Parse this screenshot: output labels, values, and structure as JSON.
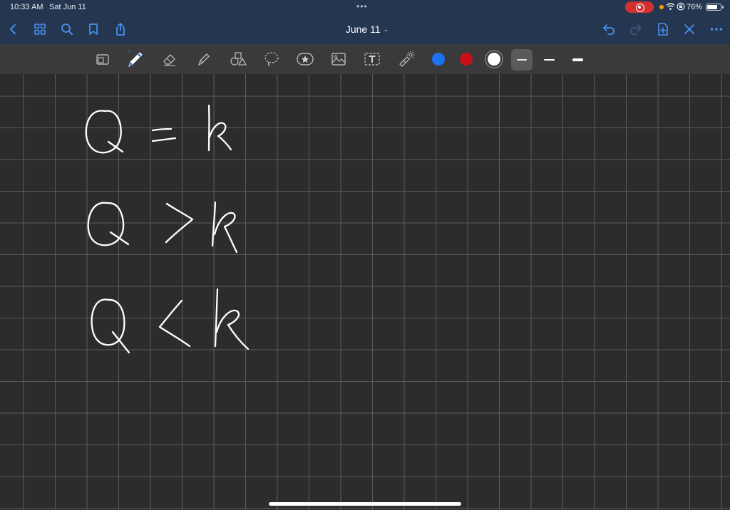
{
  "status_bar": {
    "time": "10:33 AM",
    "date": "Sat Jun 11",
    "battery_percent": "76%",
    "battery_level": 0.76,
    "icons": [
      "screen-record-icon",
      "wifi-icon",
      "rotation-lock-icon",
      "battery-icon"
    ]
  },
  "nav_bar": {
    "title": "June 11",
    "left_buttons": [
      "back-icon",
      "grid-icon",
      "search-icon",
      "bookmark-icon",
      "share-icon"
    ],
    "right_buttons": [
      "undo-icon",
      "redo-icon",
      "add-page-icon",
      "close-icon",
      "more-icon"
    ]
  },
  "toolbar": {
    "tools": [
      "page-zoom-icon",
      "pen-icon",
      "eraser-icon",
      "highlighter-icon",
      "shapes-icon",
      "lasso-icon",
      "sticker-icon",
      "image-icon",
      "text-icon",
      "laser-pointer-icon"
    ],
    "selected_tool": "pen-icon",
    "colors": [
      "#1a73f0",
      "#c9101a",
      "#ffffff"
    ],
    "selected_color": "#ffffff",
    "stroke_widths": [
      "thin",
      "medium",
      "thick"
    ],
    "selected_width": "thin"
  },
  "canvas": {
    "background": "#2c2c2e",
    "grid_color": "#5b5b5e",
    "handwriting_lines": [
      "Q = k",
      "Q > k",
      "Q < k"
    ],
    "ink_color": "#ffffff"
  }
}
